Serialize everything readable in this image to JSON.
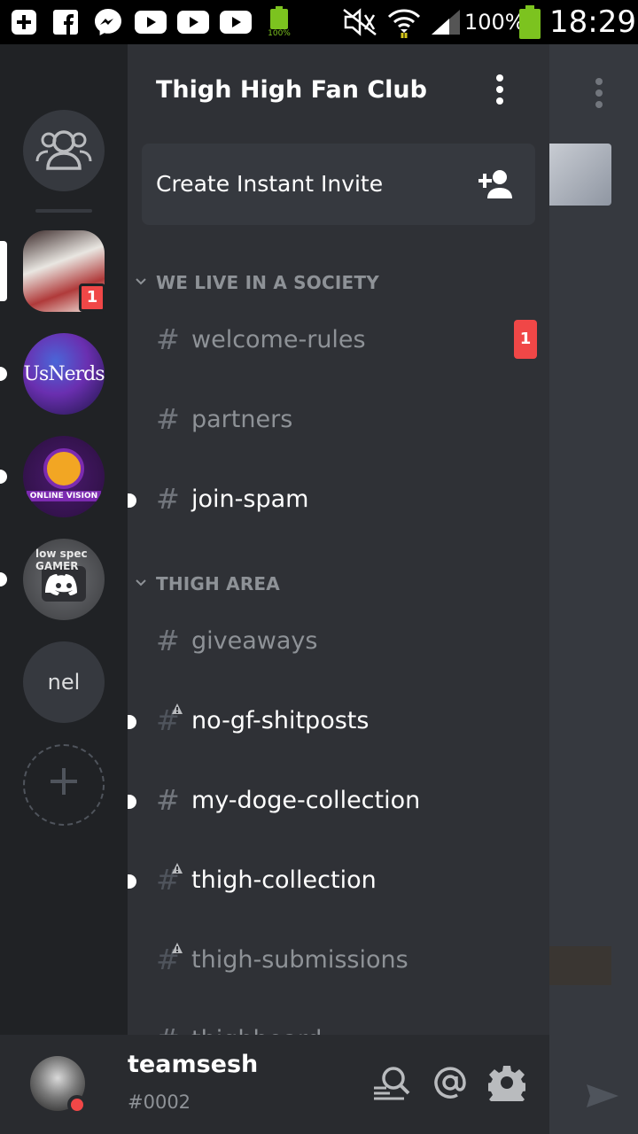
{
  "status_bar": {
    "battery_small_label": "100%",
    "battery_percent": "100%",
    "time": "18:29",
    "icons": [
      "add-box-icon",
      "facebook-icon",
      "messenger-icon",
      "youtube-icon",
      "youtube-icon",
      "youtube-icon",
      "battery-full-icon",
      "mute-icon",
      "wifi-icon",
      "signal-icon",
      "battery-icon"
    ]
  },
  "servers": [
    {
      "name": "direct-messages",
      "icon": "friends-icon"
    },
    {
      "name": "thigh-high-fan-club",
      "selected": true,
      "badge": "1"
    },
    {
      "name": "usnerds",
      "label": "UsNerds",
      "unread": true
    },
    {
      "name": "online-vision",
      "label": "ONLINE VISION",
      "unread": true
    },
    {
      "name": "low-spec-gamer",
      "label": "low spec GAMER",
      "unread": true
    },
    {
      "name": "nel",
      "label": "nel"
    },
    {
      "name": "add-server",
      "icon": "plus-icon"
    }
  ],
  "panel": {
    "server_title": "Thigh High Fan Club",
    "invite_label": "Create Instant Invite",
    "categories": [
      {
        "label": "WE LIVE IN A SOCIETY",
        "channels": [
          {
            "name": "welcome-rules",
            "unread": false,
            "badge": "1",
            "locked": false
          },
          {
            "name": "partners",
            "unread": false,
            "locked": false
          },
          {
            "name": "join-spam",
            "unread": true,
            "locked": false
          }
        ]
      },
      {
        "label": "THIGH AREA",
        "channels": [
          {
            "name": "giveaways",
            "unread": false,
            "locked": false
          },
          {
            "name": "no-gf-shitposts",
            "unread": true,
            "locked": true
          },
          {
            "name": "my-doge-collection",
            "unread": true,
            "locked": false
          },
          {
            "name": "thigh-collection",
            "unread": true,
            "locked": true
          },
          {
            "name": "thigh-submissions",
            "unread": false,
            "locked": true
          },
          {
            "name": "thighboard",
            "unread": false,
            "locked": false
          }
        ]
      }
    ]
  },
  "user": {
    "username": "teamsesh",
    "discriminator": "#0002",
    "status_color": "#f04747"
  },
  "colors": {
    "rail": "#202225",
    "panel": "#2f3136",
    "userbar": "#292b2f",
    "badge": "#f04747",
    "muted_text": "#8e9297"
  }
}
